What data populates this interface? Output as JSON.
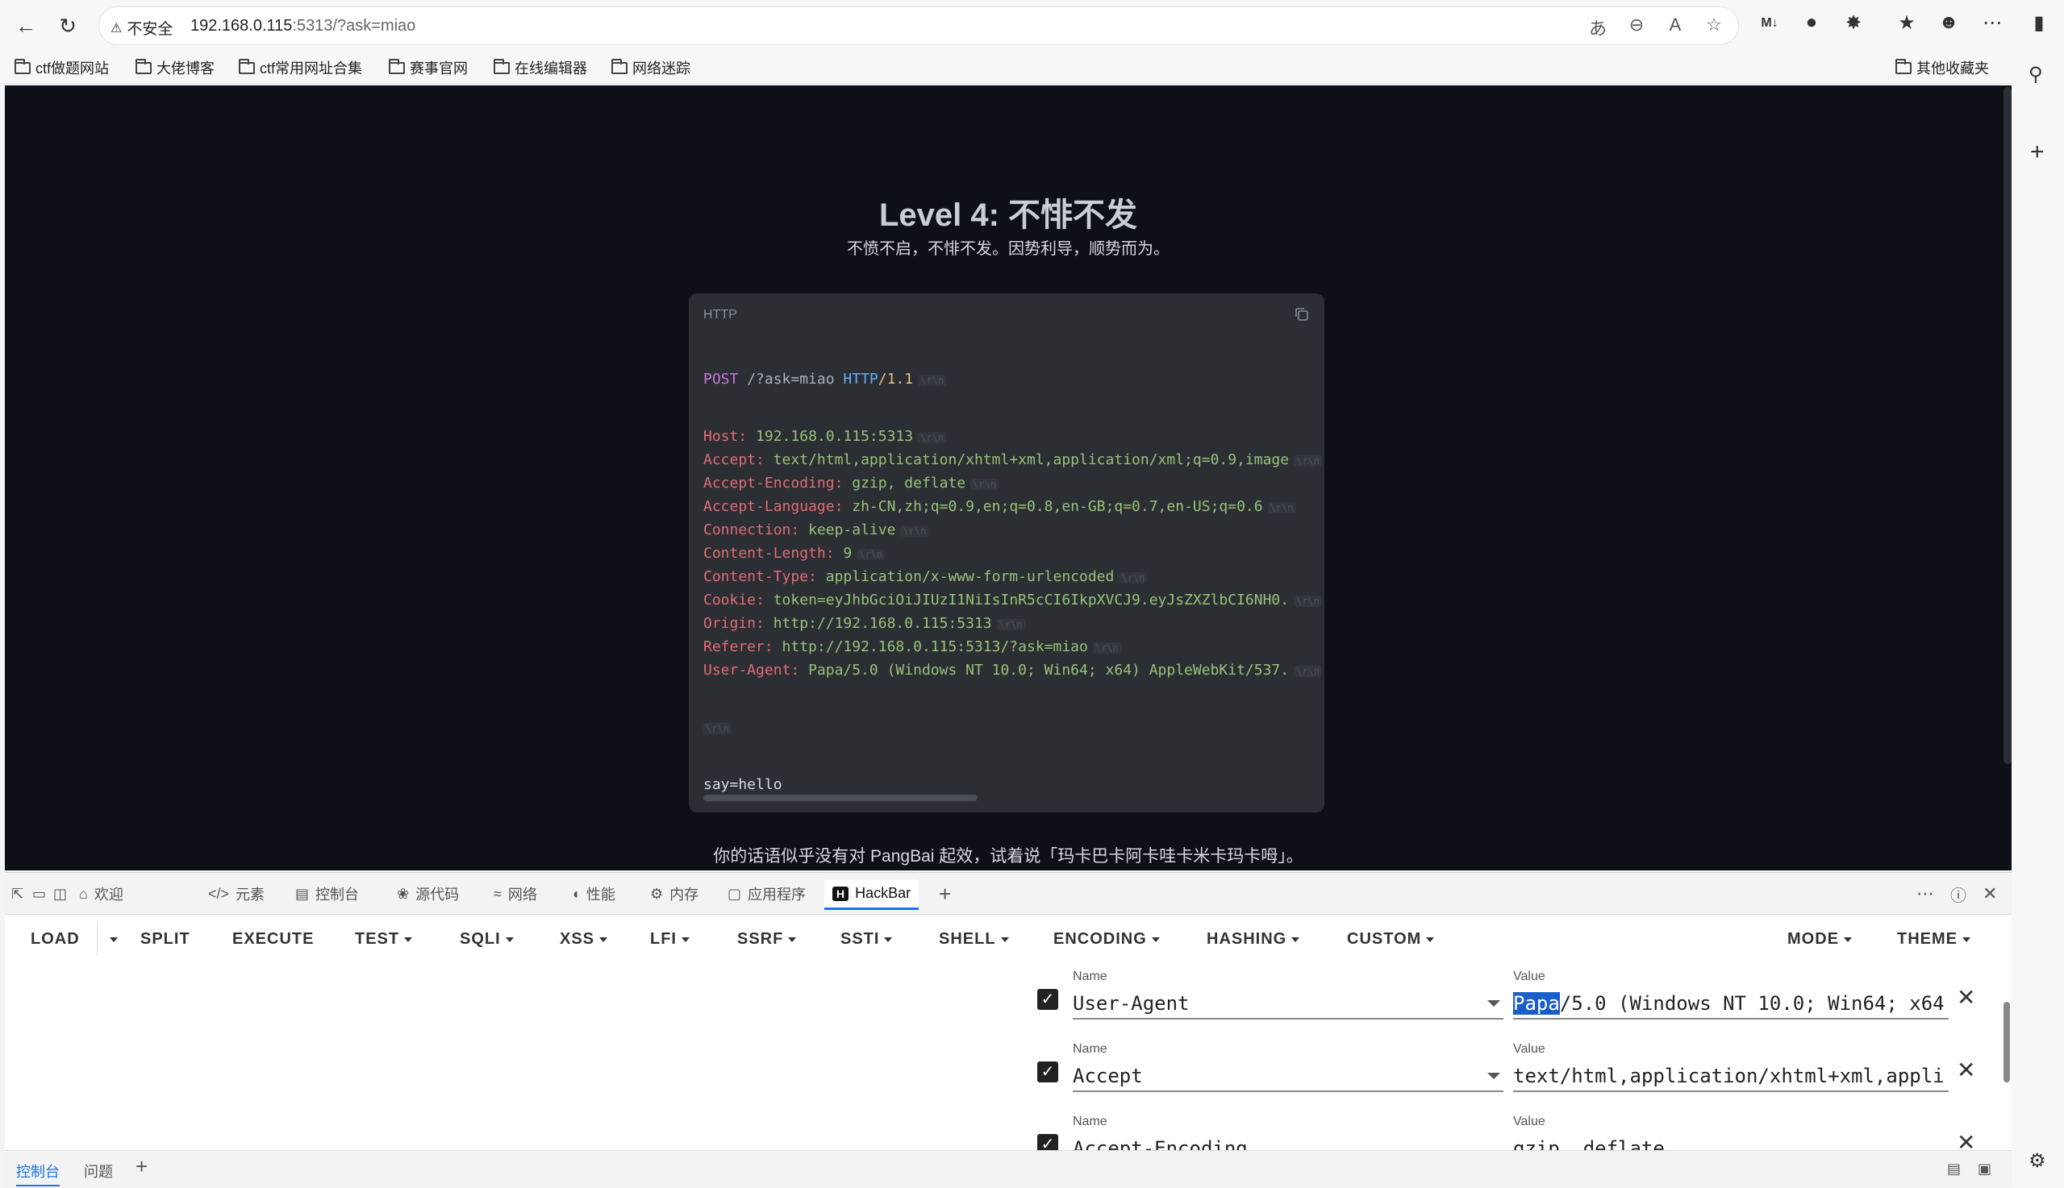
{
  "browser": {
    "security_label": "不安全",
    "url_host": "192.168.0.115",
    "url_path": ":5313/?ask=miao",
    "bookmarks": [
      "ctf做题网站",
      "大佬博客",
      "ctf常用网址合集",
      "赛事官网",
      "在线编辑器",
      "网络迷踪"
    ],
    "other_bookmarks": "其他收藏夹"
  },
  "page": {
    "title": "Level 4: 不悱不发",
    "subtitle": "不愤不启，不悱不发。因势利导，顺势而为。",
    "code_lang": "HTTP",
    "request": {
      "method": "POST",
      "path": "/?ask=miao",
      "protocol": "HTTP",
      "version": "/1.1",
      "headers": [
        {
          "key": "Host",
          "value": "192.168.0.115:5313"
        },
        {
          "key": "Accept",
          "value": "text/html,application/xhtml+xml,application/xml;q=0.9,image"
        },
        {
          "key": "Accept-Encoding",
          "value": "gzip, deflate"
        },
        {
          "key": "Accept-Language",
          "value": "zh-CN,zh;q=0.9,en;q=0.8,en-GB;q=0.7,en-US;q=0.6"
        },
        {
          "key": "Connection",
          "value": "keep-alive"
        },
        {
          "key": "Content-Length",
          "value": "9"
        },
        {
          "key": "Content-Type",
          "value": "application/x-www-form-urlencoded"
        },
        {
          "key": "Cookie",
          "value": "token=eyJhbGciOiJIUzI1NiIsInR5cCI6IkpXVCJ9.eyJsZXZlbCI6NH0."
        },
        {
          "key": "Origin",
          "value": "http://192.168.0.115:5313"
        },
        {
          "key": "Referer",
          "value": "http://192.168.0.115:5313/?ask=miao"
        },
        {
          "key": "User-Agent",
          "value": "Papa/5.0 (Windows NT 10.0; Win64; x64) AppleWebKit/537."
        }
      ],
      "crlf": "\\r\\n",
      "body": "say=hello"
    },
    "message": "你的话语似乎没有对 PangBai 起效，试着说「玛卡巴卡阿卡哇卡米卡玛卡呣」。"
  },
  "devtools": {
    "tabs": [
      "欢迎",
      "元素",
      "控制台",
      "源代码",
      "网络",
      "性能",
      "内存",
      "应用程序",
      "HackBar"
    ],
    "bottom_tabs": [
      "控制台",
      "问题"
    ]
  },
  "hackbar": {
    "menu": [
      "LOAD",
      "SPLIT",
      "EXECUTE",
      "TEST",
      "SQLI",
      "XSS",
      "LFI",
      "SSRF",
      "SSTI",
      "SHELL",
      "ENCODING",
      "HASHING",
      "CUSTOM",
      "MODE",
      "THEME"
    ],
    "name_label": "Name",
    "value_label": "Value",
    "rows": [
      {
        "name": "User-Agent",
        "value_selected": "Papa",
        "value_rest": "/5.0 (Windows NT 10.0; Win64; x64"
      },
      {
        "name": "Accept",
        "value_selected": "",
        "value_rest": "text/html,application/xhtml+xml,appli"
      },
      {
        "name": "Accept-Encoding",
        "value_selected": "",
        "value_rest": "gzip, deflate"
      }
    ]
  }
}
